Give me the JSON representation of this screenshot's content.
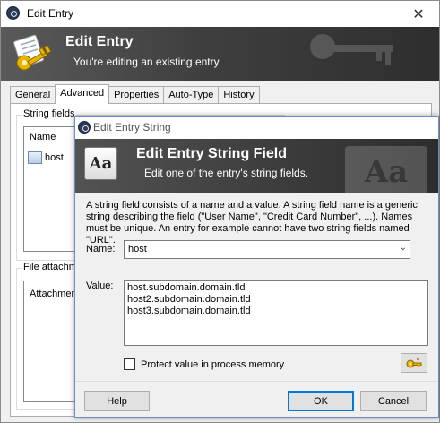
{
  "outer_window": {
    "title": "Edit Entry",
    "close_glyph": "✕",
    "banner_title": "Edit Entry",
    "banner_subtitle": "You're editing an existing entry.",
    "tabs": [
      {
        "label": "General",
        "active": false
      },
      {
        "label": "Advanced",
        "active": true
      },
      {
        "label": "Properties",
        "active": false
      },
      {
        "label": "Auto-Type",
        "active": false
      },
      {
        "label": "History",
        "active": false
      }
    ],
    "string_fields_legend": "String fields",
    "list_column_name": "Name",
    "list_rows": [
      "host"
    ],
    "file_attachments_legend": "File attachm",
    "attachments_column": "Attachmen"
  },
  "dialog": {
    "title": "Edit Entry String",
    "banner_title": "Edit Entry String Field",
    "banner_subtitle": "Edit one of the entry's string fields.",
    "icon_text": "Aa",
    "description": "A string field consists of a name and a value. A string field name is a generic string describing the field (\"User Name\", \"Credit Card Number\", ...). Names must be unique. An entry for example cannot have two string fields named \"URL\".",
    "name_label": "Name:",
    "name_value": "host",
    "value_label": "Value:",
    "value_lines": [
      "host.subdomain.domain.tld",
      "host2.subdomain.domain.tld",
      "host3.subdomain.domain.tld"
    ],
    "protect_label": "Protect value in process memory",
    "protect_checked": false,
    "help_label": "Help",
    "ok_label": "OK",
    "cancel_label": "Cancel"
  },
  "colors": {
    "banner": "#3f3f3f",
    "dialog_border": "#6b8fc3",
    "default_button": "#0078d7"
  }
}
